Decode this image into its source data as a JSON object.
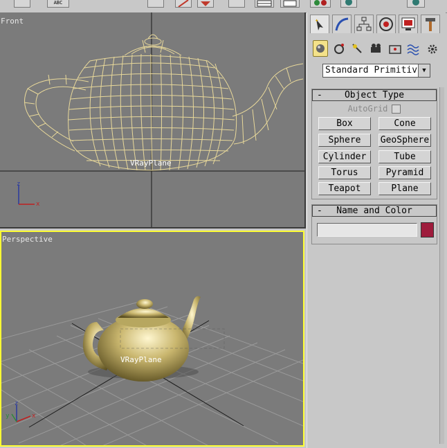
{
  "toolbar": {
    "icons": [
      "select-icon",
      "text-abc-icon",
      "rotate-icon",
      "scale-icon",
      "window-crossing-icon",
      "named-selection-icon",
      "mirror-icon",
      "align-icon",
      "material-editor-icon",
      "render-icon"
    ],
    "abc_label": "ABC"
  },
  "viewports": {
    "front": {
      "label": "Front",
      "object_label": "VRayPlane",
      "axis_labels": [
        "z",
        "x"
      ]
    },
    "perspective": {
      "label": "Perspective",
      "object_label": "VRayPlane",
      "axis_labels": [
        "z",
        "y",
        "x"
      ],
      "active_border_color": "#ffff33"
    }
  },
  "command_panel": {
    "tabs": [
      "create-tab",
      "modify-tab",
      "hierarchy-tab",
      "motion-tab",
      "display-tab",
      "utilities-tab"
    ],
    "active_tab": "create-tab",
    "subcategories": [
      "geometry-icon",
      "shapes-icon",
      "lights-icon",
      "cameras-icon",
      "helpers-icon",
      "space-warps-icon",
      "systems-icon"
    ],
    "active_subcategory": "geometry-icon",
    "category_dropdown": "Standard Primitiv",
    "object_type": {
      "header": "Object Type",
      "collapse_symbol": "-",
      "autogrid_label": "AutoGrid",
      "autogrid_checked": false,
      "buttons": [
        "Box",
        "Cone",
        "Sphere",
        "GeoSphere",
        "Cylinder",
        "Tube",
        "Torus",
        "Pyramid",
        "Teapot",
        "Plane"
      ]
    },
    "name_and_color": {
      "header": "Name and Color",
      "collapse_symbol": "-",
      "name_value": "",
      "color": "#9e1c3c"
    }
  }
}
